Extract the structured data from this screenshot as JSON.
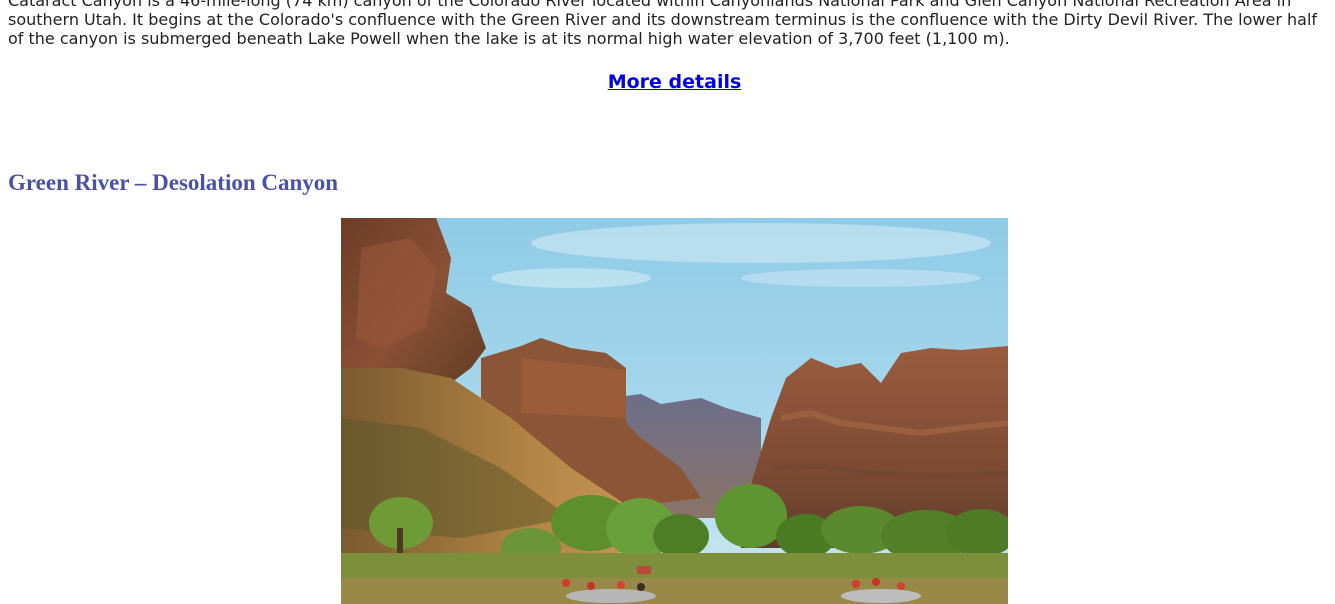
{
  "article": {
    "description": "Cataract Canyon is a 46-mile-long (74 km) canyon of the Colorado River located within Canyonlands National Park and Glen Canyon National Recreation Area in southern Utah. It begins at the Colorado's confluence with the Green River and its downstream terminus is the confluence with the Dirty Devil River. The lower half of the canyon is submerged beneath Lake Powell when the lake is at its normal high water elevation of 3,700 feet (1,100 m).",
    "more_details_label": "More details"
  },
  "section": {
    "heading": "Green River – Desolation Canyon"
  },
  "colors": {
    "link": "#0000ee",
    "heading": "#4a52a8",
    "body_text": "#222222"
  }
}
